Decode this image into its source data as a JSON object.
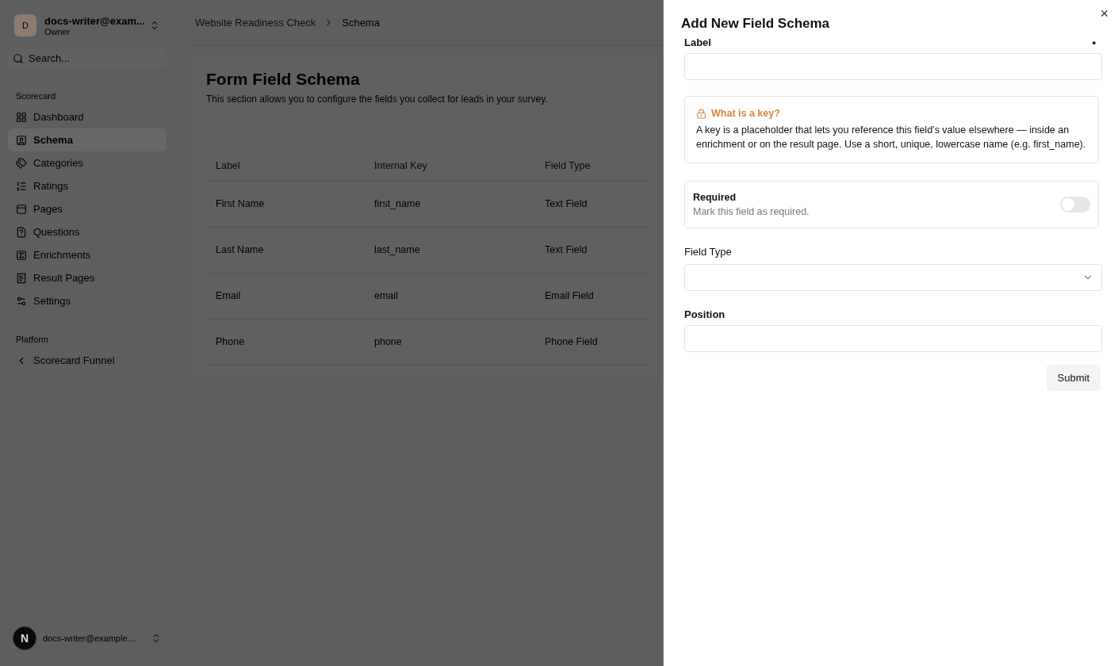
{
  "account": {
    "initial": "D",
    "email": "docs-writer@exam...",
    "role": "Owner"
  },
  "search": {
    "placeholder": "Search..."
  },
  "sidebar": {
    "sections": [
      {
        "title": "Scorecard",
        "items": [
          {
            "label": "Dashboard",
            "selected": false
          },
          {
            "label": "Schema",
            "selected": true
          },
          {
            "label": "Categories",
            "selected": false
          },
          {
            "label": "Ratings",
            "selected": false
          },
          {
            "label": "Pages",
            "selected": false
          },
          {
            "label": "Questions",
            "selected": false
          },
          {
            "label": "Enrichments",
            "selected": false
          },
          {
            "label": "Result Pages",
            "selected": false
          },
          {
            "label": "Settings",
            "selected": false
          }
        ]
      },
      {
        "title": "Platform",
        "items": [
          {
            "label": "Scorecard Funnel",
            "selected": false
          }
        ]
      }
    ]
  },
  "user": {
    "initial": "N",
    "email": "docs-writer@example...."
  },
  "breadcrumb": [
    "Website Readiness Check",
    "Schema"
  ],
  "page": {
    "title": "Form Field Schema",
    "description": "This section allows you to configure the fields you collect for leads in your survey."
  },
  "table": {
    "columns": [
      "Label",
      "Internal Key",
      "Field Type"
    ],
    "rows": [
      [
        "First Name",
        "first_name",
        "Text Field"
      ],
      [
        "Last Name",
        "last_name",
        "Text Field"
      ],
      [
        "Email",
        "email",
        "Email Field"
      ],
      [
        "Phone",
        "phone",
        "Phone Field"
      ]
    ]
  },
  "dialog": {
    "title": "Add New Field Schema",
    "close": "×",
    "label_field": {
      "label": "Label",
      "marker": "•"
    },
    "info": {
      "title": "What is a key?",
      "text": "A key is a placeholder that lets you reference this field’s value elsewhere — inside an enrichment or on the result page. Use a short, unique, lowercase name (e.g. first_name)."
    },
    "required": {
      "title": "Required",
      "description": "Mark this field as required.",
      "on": false
    },
    "field_type": {
      "label": "Field Type"
    },
    "position": {
      "label": "Position"
    },
    "submit": "Submit"
  }
}
